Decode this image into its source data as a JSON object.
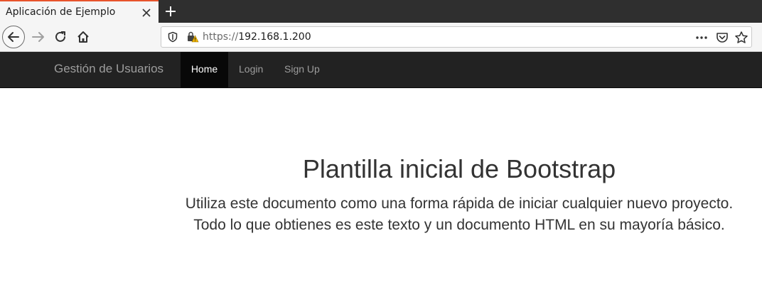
{
  "browser": {
    "tab": {
      "title": "Aplicación de Ejemplo"
    },
    "url": {
      "scheme": "https://",
      "host": "192.168.1.200"
    },
    "icons": {
      "close": "close-icon",
      "new_tab": "plus-icon",
      "back": "arrow-left-icon",
      "forward": "arrow-right-icon",
      "reload": "reload-icon",
      "home": "home-icon",
      "shield": "shield-icon",
      "lock": "lock-warning-icon",
      "more": "more-icon",
      "pocket": "pocket-icon",
      "bookmark": "star-icon"
    },
    "colors": {
      "tab_accent": "#e8542c",
      "warning": "#f0b400"
    }
  },
  "navbar": {
    "brand": "Gestión de Usuarios",
    "items": [
      {
        "label": "Home",
        "active": true
      },
      {
        "label": "Login",
        "active": false
      },
      {
        "label": "Sign Up",
        "active": false
      }
    ],
    "colors": {
      "background": "#222222",
      "active_background": "#080808"
    }
  },
  "main": {
    "title": "Plantilla inicial de Bootstrap",
    "lead_line1": "Utiliza este documento como una forma rápida de iniciar cualquier nuevo proyecto.",
    "lead_line2": "Todo lo que obtienes es este texto y un documento HTML en su mayoría básico."
  }
}
